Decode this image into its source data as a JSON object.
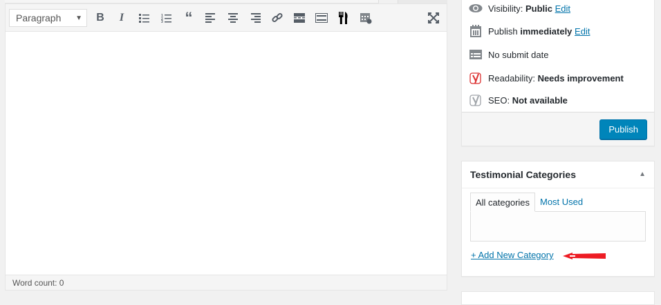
{
  "editor": {
    "format_select": "Paragraph",
    "word_count": "Word count: 0"
  },
  "publish": {
    "visibility_label": "Visibility:",
    "visibility_value": "Public",
    "visibility_edit": "Edit",
    "publish_label": "Publish",
    "publish_value": "immediately",
    "publish_edit": "Edit",
    "submit_date": "No submit date",
    "readability_label": "Readability:",
    "readability_value": "Needs improvement",
    "seo_label": "SEO:",
    "seo_value": "Not available",
    "publish_button": "Publish"
  },
  "categories": {
    "title": "Testimonial Categories",
    "tabs": [
      "All categories",
      "Most Used"
    ],
    "add_new": "+ Add New Category"
  },
  "colors": {
    "accent": "#0085ba",
    "link": "#0073aa",
    "annotation_arrow": "#ed1c24"
  }
}
